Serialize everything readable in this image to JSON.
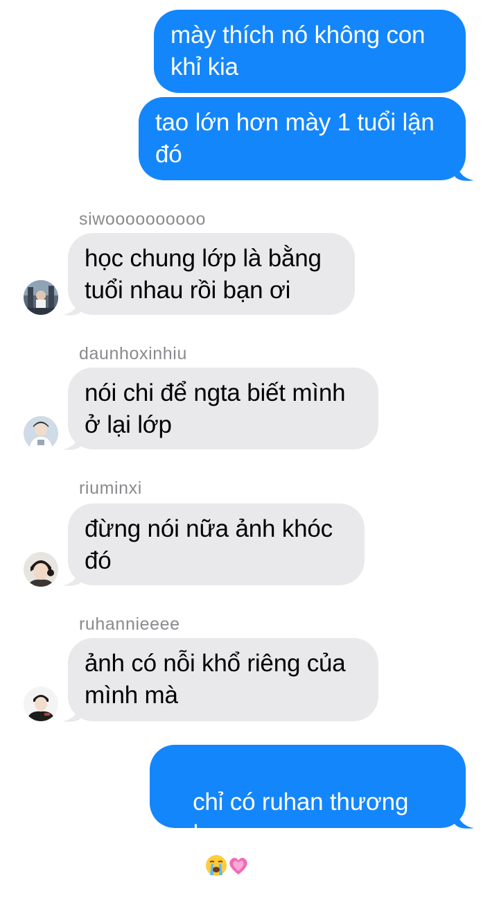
{
  "colors": {
    "outgoing_bubble": "#1486fb",
    "incoming_bubble": "#e9e9eb",
    "sender_name": "#8a8a8e"
  },
  "messages": [
    {
      "direction": "outgoing",
      "text": "mày thích nó không con\nkhỉ kia"
    },
    {
      "direction": "outgoing",
      "text": "tao lớn hơn mày 1 tuổi lận\nđó"
    },
    {
      "direction": "incoming",
      "sender": "siwoooooooooo",
      "avatar": "avatar-siwoo",
      "text": "học chung lớp là bằng\ntuổi nhau rồi bạn ơi"
    },
    {
      "direction": "incoming",
      "sender": "daunhoxinhiu",
      "avatar": "avatar-daunhoxinhiu",
      "text": "nói chi để ngta biết mình\nở lại lớp"
    },
    {
      "direction": "incoming",
      "sender": "riuminxi",
      "avatar": "avatar-riuminxi",
      "text": "đừng nói nữa ảnh khóc\nđó"
    },
    {
      "direction": "incoming",
      "sender": "ruhannieeee",
      "avatar": "avatar-ruhannieeee",
      "text": "ảnh có nỗi khổ riêng của\nmình mà"
    },
    {
      "direction": "outgoing",
      "text": "chỉ có ruhan thương anh\nthôi",
      "emojis": [
        "loudly-crying-face-emoji",
        "growing-heart-emoji"
      ]
    }
  ]
}
